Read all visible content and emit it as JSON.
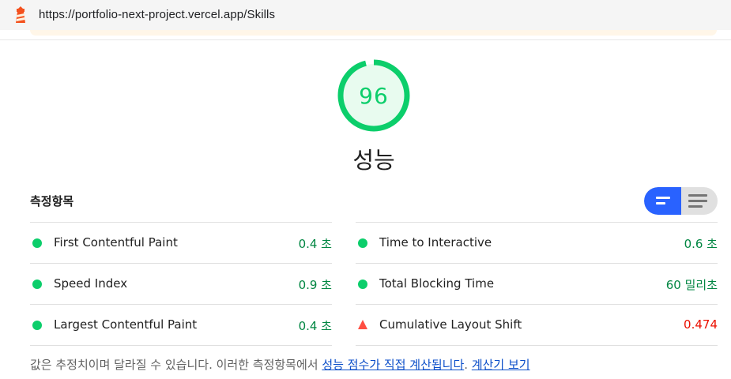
{
  "address_bar": {
    "url": "https://portfolio-next-project.vercel.app/Skills",
    "logo_icon": "lighthouse-icon"
  },
  "score": {
    "value": "96",
    "fraction": 0.96,
    "title": "성능",
    "color": "#0cce6b"
  },
  "metrics": {
    "heading": "측정항목",
    "toggle": {
      "summary_icon": "lines-summary-icon",
      "detail_icon": "lines-detail-icon",
      "active": "summary"
    },
    "left": [
      {
        "name": "First Contentful Paint",
        "value": "0.4 초",
        "status": "pass"
      },
      {
        "name": "Speed Index",
        "value": "0.9 초",
        "status": "pass"
      },
      {
        "name": "Largest Contentful Paint",
        "value": "0.4 초",
        "status": "pass"
      }
    ],
    "right": [
      {
        "name": "Time to Interactive",
        "value": "0.6 초",
        "status": "pass"
      },
      {
        "name": "Total Blocking Time",
        "value": "60 밀리초",
        "status": "pass"
      },
      {
        "name": "Cumulative Layout Shift",
        "value": "0.474",
        "status": "fail"
      }
    ]
  },
  "footnote": {
    "text": "값은 추정치이며 달라질 수 있습니다. 이러한 측정항목에서 ",
    "link1": "성능 점수가 직접 계산됩니다",
    "sep": ". ",
    "link2": "계산기 보기"
  },
  "colors": {
    "pass": "#0cce6b",
    "fail": "#ff4e42",
    "accent": "#2962ff"
  }
}
